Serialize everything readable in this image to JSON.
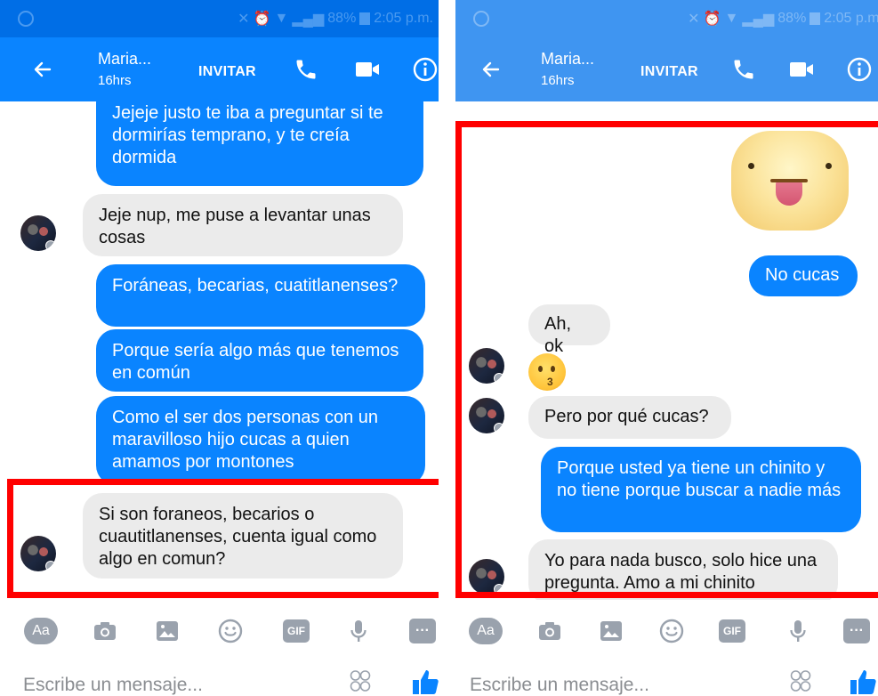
{
  "status": {
    "battery": "88%",
    "time": "2:05 p.m."
  },
  "header": {
    "contact_name": "Maria...",
    "last_active": "16hrs",
    "invite_label": "INVITAR"
  },
  "left_chat": {
    "messages": [
      {
        "from": "me",
        "text": "Jejeje justo te iba a preguntar si te dormirías temprano, y te creía dormida"
      },
      {
        "from": "them",
        "text": "Jeje nup, me puse a levantar unas cosas"
      },
      {
        "from": "me",
        "text": "Foráneas, becarias, cuatitlanenses?"
      },
      {
        "from": "me",
        "text": "Porque sería algo más que tenemos en común"
      },
      {
        "from": "me",
        "text": "Como el ser dos personas con un maravilloso hijo cucas a quien amamos por montones"
      },
      {
        "from": "them",
        "text": "Si son foraneos, becarios o cuautitlanenses, cuenta igual como algo en comun?"
      }
    ]
  },
  "right_chat": {
    "messages": [
      {
        "from": "me",
        "type": "sticker",
        "sticker": "tongue-out-sticker"
      },
      {
        "from": "me",
        "text": "No cucas"
      },
      {
        "from": "them",
        "text": "Ah, ok"
      },
      {
        "from": "them",
        "type": "emoji",
        "emoji": "kissing-face-emoji"
      },
      {
        "from": "them",
        "text": "Pero por qué cucas?"
      },
      {
        "from": "me",
        "text": "Porque usted ya tiene un chinito y no tiene porque buscar a nadie más"
      },
      {
        "from": "them",
        "text": "Yo para nada busco, solo hice una pregunta. Amo a mi chinito"
      }
    ]
  },
  "toolbar": {
    "aa_label": "Aa",
    "gif_label": "GIF",
    "more_label": "···"
  },
  "composer": {
    "placeholder": "Escribe un mensaje..."
  },
  "colors": {
    "brand": "#0a84ff",
    "status_bar": "#006ee6",
    "incoming_bubble": "#ebebeb",
    "highlight": "#ff0000",
    "icon_gray": "#9aa2ad"
  }
}
